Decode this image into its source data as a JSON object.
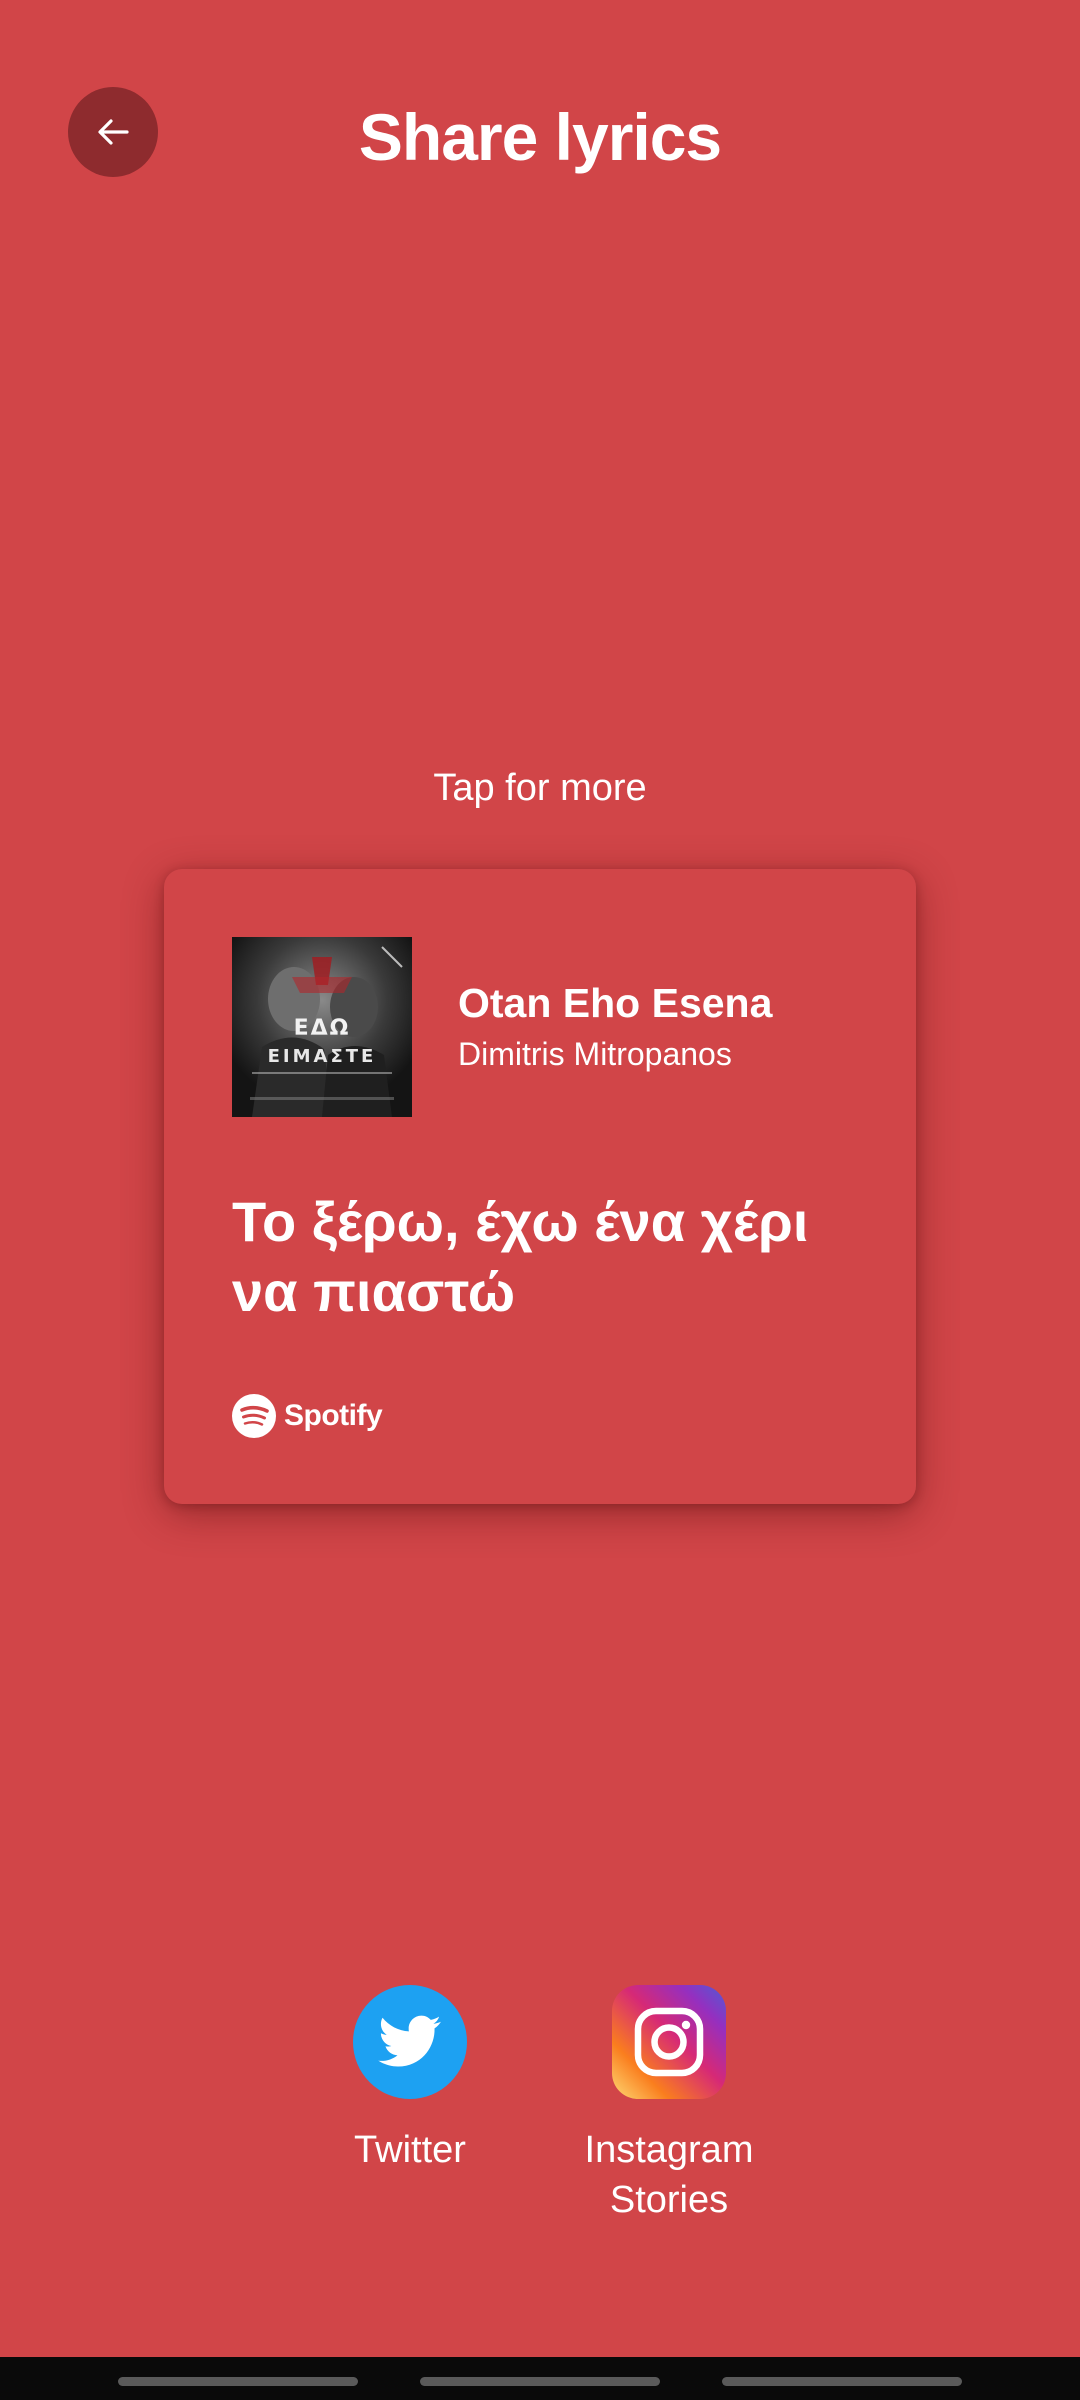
{
  "header": {
    "title": "Share lyrics",
    "back_icon": "arrow-left-icon"
  },
  "hint": "Tap for more",
  "card": {
    "album_art_icon": "album-cover-image",
    "album_cover_text": "ΕΔΩ ΕΙΜΑΣΤΕ",
    "song_title": "Otan Eho Esena",
    "artist": "Dimitris Mitropanos",
    "lyrics": "Το ξέρω, έχω ένα χέρι να πιαστώ",
    "brand": "Spotify",
    "brand_icon": "spotify-logo-icon"
  },
  "share": [
    {
      "label": "Twitter",
      "icon": "twitter-bird-icon",
      "color": "#1DA1F2"
    },
    {
      "label": "Instagram Stories",
      "icon": "instagram-icon"
    }
  ],
  "colors": {
    "background": "#D14548",
    "back_button": "#8E2B2E",
    "text": "#FFFFFF",
    "nav_bar": "#0A0A0A"
  }
}
